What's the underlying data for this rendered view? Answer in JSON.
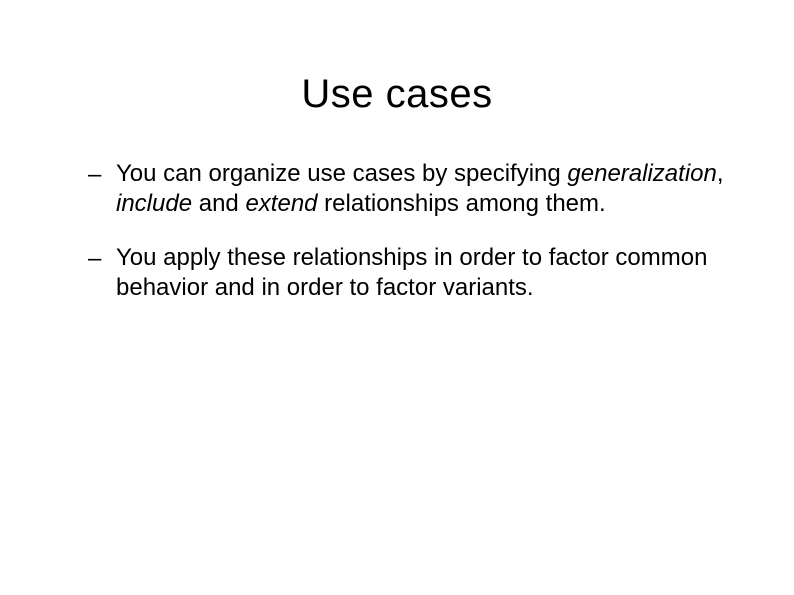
{
  "title": "Use cases",
  "bullets": [
    {
      "dash": "–",
      "text_prefix": "You can organize use cases by specifying ",
      "italic1": "generalization",
      "mid1": ", ",
      "italic2": "include",
      "mid2": " and ",
      "italic3": "extend",
      "text_suffix": " relationships among them."
    },
    {
      "dash": "–",
      "text_full": "You apply these relationships in order to factor common behavior and in order to factor variants."
    }
  ]
}
